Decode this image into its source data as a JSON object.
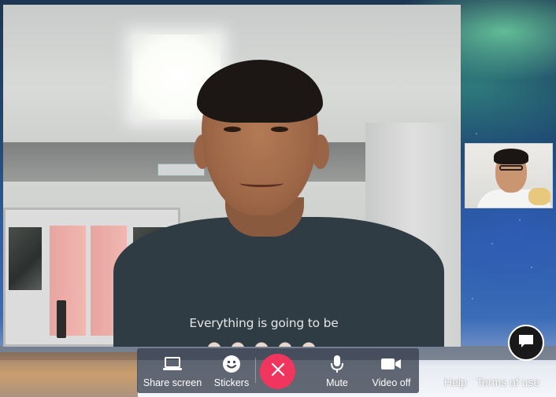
{
  "call": {
    "main_video": {
      "shirt_text": "Everything is going to be"
    },
    "controls": {
      "share_screen_label": "Share screen",
      "stickers_label": "Stickers",
      "mute_label": "Mute",
      "video_off_label": "Video off",
      "end_call_icon": "close-icon",
      "share_screen_icon": "laptop-icon",
      "stickers_icon": "smiley-icon",
      "mute_icon": "microphone-icon",
      "video_off_icon": "video-camera-icon"
    },
    "footer": {
      "help_label": "Help",
      "terms_label": "Terms of use"
    },
    "chat": {
      "icon": "chat-bubble-icon"
    }
  },
  "colors": {
    "end_call": "#f0355f",
    "control_bar": "#38404e",
    "chat_button": "#191919",
    "text": "#ffffff"
  }
}
